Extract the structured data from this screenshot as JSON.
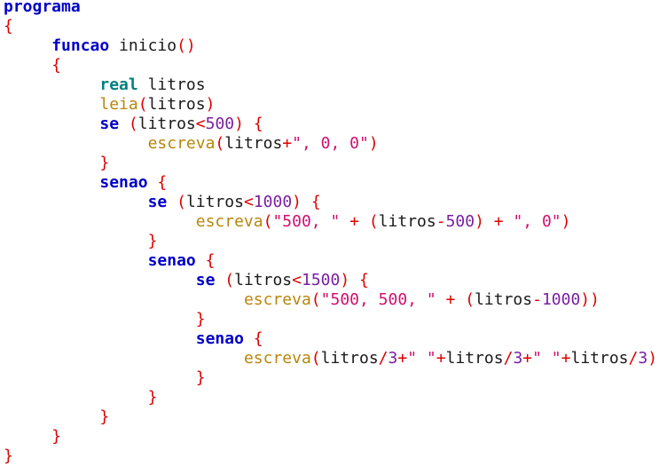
{
  "colors": {
    "keyword": "#0000c8",
    "type": "#008080",
    "function": "#b8860b",
    "number": "#7a1fa2",
    "string": "#d01070",
    "brace": "#dd0000",
    "text": "#1a1a1a",
    "background": "#ffffff"
  },
  "code": {
    "lines": [
      [
        [
          "kw",
          "programa"
        ]
      ],
      [
        [
          "brace",
          "{"
        ]
      ],
      [
        [
          "plain",
          "     "
        ],
        [
          "kw",
          "funcao"
        ],
        [
          "plain",
          " inicio"
        ],
        [
          "brace",
          "()"
        ]
      ],
      [
        [
          "plain",
          "     "
        ],
        [
          "brace",
          "{"
        ]
      ],
      [
        [
          "plain",
          "          "
        ],
        [
          "type",
          "real"
        ],
        [
          "plain",
          " litros"
        ]
      ],
      [
        [
          "plain",
          "          "
        ],
        [
          "fn",
          "leia"
        ],
        [
          "brace",
          "("
        ],
        [
          "plain",
          "litros"
        ],
        [
          "brace",
          ")"
        ]
      ],
      [
        [
          "plain",
          "          "
        ],
        [
          "kw",
          "se"
        ],
        [
          "plain",
          " "
        ],
        [
          "brace",
          "("
        ],
        [
          "plain",
          "litros"
        ],
        [
          "op",
          "<"
        ],
        [
          "num",
          "500"
        ],
        [
          "brace",
          ")"
        ],
        [
          "plain",
          " "
        ],
        [
          "brace",
          "{"
        ]
      ],
      [
        [
          "plain",
          "               "
        ],
        [
          "fn",
          "escreva"
        ],
        [
          "brace",
          "("
        ],
        [
          "plain",
          "litros"
        ],
        [
          "op",
          "+"
        ],
        [
          "str",
          "\", 0, 0\""
        ],
        [
          "brace",
          ")"
        ]
      ],
      [
        [
          "plain",
          "          "
        ],
        [
          "brace",
          "}"
        ]
      ],
      [
        [
          "plain",
          "          "
        ],
        [
          "kw",
          "senao"
        ],
        [
          "plain",
          " "
        ],
        [
          "brace",
          "{"
        ]
      ],
      [
        [
          "plain",
          "               "
        ],
        [
          "kw",
          "se"
        ],
        [
          "plain",
          " "
        ],
        [
          "brace",
          "("
        ],
        [
          "plain",
          "litros"
        ],
        [
          "op",
          "<"
        ],
        [
          "num",
          "1000"
        ],
        [
          "brace",
          ")"
        ],
        [
          "plain",
          " "
        ],
        [
          "brace",
          "{"
        ]
      ],
      [
        [
          "plain",
          "                    "
        ],
        [
          "fn",
          "escreva"
        ],
        [
          "brace",
          "("
        ],
        [
          "str",
          "\"500, \""
        ],
        [
          "plain",
          " "
        ],
        [
          "op",
          "+"
        ],
        [
          "plain",
          " "
        ],
        [
          "brace",
          "("
        ],
        [
          "plain",
          "litros"
        ],
        [
          "op",
          "-"
        ],
        [
          "num",
          "500"
        ],
        [
          "brace",
          ")"
        ],
        [
          "plain",
          " "
        ],
        [
          "op",
          "+"
        ],
        [
          "plain",
          " "
        ],
        [
          "str",
          "\", 0\""
        ],
        [
          "brace",
          ")"
        ]
      ],
      [
        [
          "plain",
          "               "
        ],
        [
          "brace",
          "}"
        ]
      ],
      [
        [
          "plain",
          "               "
        ],
        [
          "kw",
          "senao"
        ],
        [
          "plain",
          " "
        ],
        [
          "brace",
          "{"
        ]
      ],
      [
        [
          "plain",
          "                    "
        ],
        [
          "kw",
          "se"
        ],
        [
          "plain",
          " "
        ],
        [
          "brace",
          "("
        ],
        [
          "plain",
          "litros"
        ],
        [
          "op",
          "<"
        ],
        [
          "num",
          "1500"
        ],
        [
          "brace",
          ")"
        ],
        [
          "plain",
          " "
        ],
        [
          "brace",
          "{"
        ]
      ],
      [
        [
          "plain",
          "                         "
        ],
        [
          "fn",
          "escreva"
        ],
        [
          "brace",
          "("
        ],
        [
          "str",
          "\"500, 500, \""
        ],
        [
          "plain",
          " "
        ],
        [
          "op",
          "+"
        ],
        [
          "plain",
          " "
        ],
        [
          "brace",
          "("
        ],
        [
          "plain",
          "litros"
        ],
        [
          "op",
          "-"
        ],
        [
          "num",
          "1000"
        ],
        [
          "brace",
          "))"
        ]
      ],
      [
        [
          "plain",
          "                    "
        ],
        [
          "brace",
          "}"
        ]
      ],
      [
        [
          "plain",
          "                    "
        ],
        [
          "kw",
          "senao"
        ],
        [
          "plain",
          " "
        ],
        [
          "brace",
          "{"
        ]
      ],
      [
        [
          "plain",
          "                         "
        ],
        [
          "fn",
          "escreva"
        ],
        [
          "brace",
          "("
        ],
        [
          "plain",
          "litros"
        ],
        [
          "op",
          "/"
        ],
        [
          "num",
          "3"
        ],
        [
          "op",
          "+"
        ],
        [
          "str",
          "\" \""
        ],
        [
          "op",
          "+"
        ],
        [
          "plain",
          "litros"
        ],
        [
          "op",
          "/"
        ],
        [
          "num",
          "3"
        ],
        [
          "op",
          "+"
        ],
        [
          "str",
          "\" \""
        ],
        [
          "op",
          "+"
        ],
        [
          "plain",
          "litros"
        ],
        [
          "op",
          "/"
        ],
        [
          "num",
          "3"
        ],
        [
          "brace",
          ")"
        ]
      ],
      [
        [
          "plain",
          "                    "
        ],
        [
          "brace",
          "}"
        ]
      ],
      [
        [
          "plain",
          "               "
        ],
        [
          "brace",
          "}"
        ]
      ],
      [
        [
          "plain",
          "          "
        ],
        [
          "brace",
          "}"
        ]
      ],
      [
        [
          "plain",
          "     "
        ],
        [
          "brace",
          "}"
        ]
      ],
      [
        [
          "brace",
          "}"
        ]
      ]
    ]
  }
}
